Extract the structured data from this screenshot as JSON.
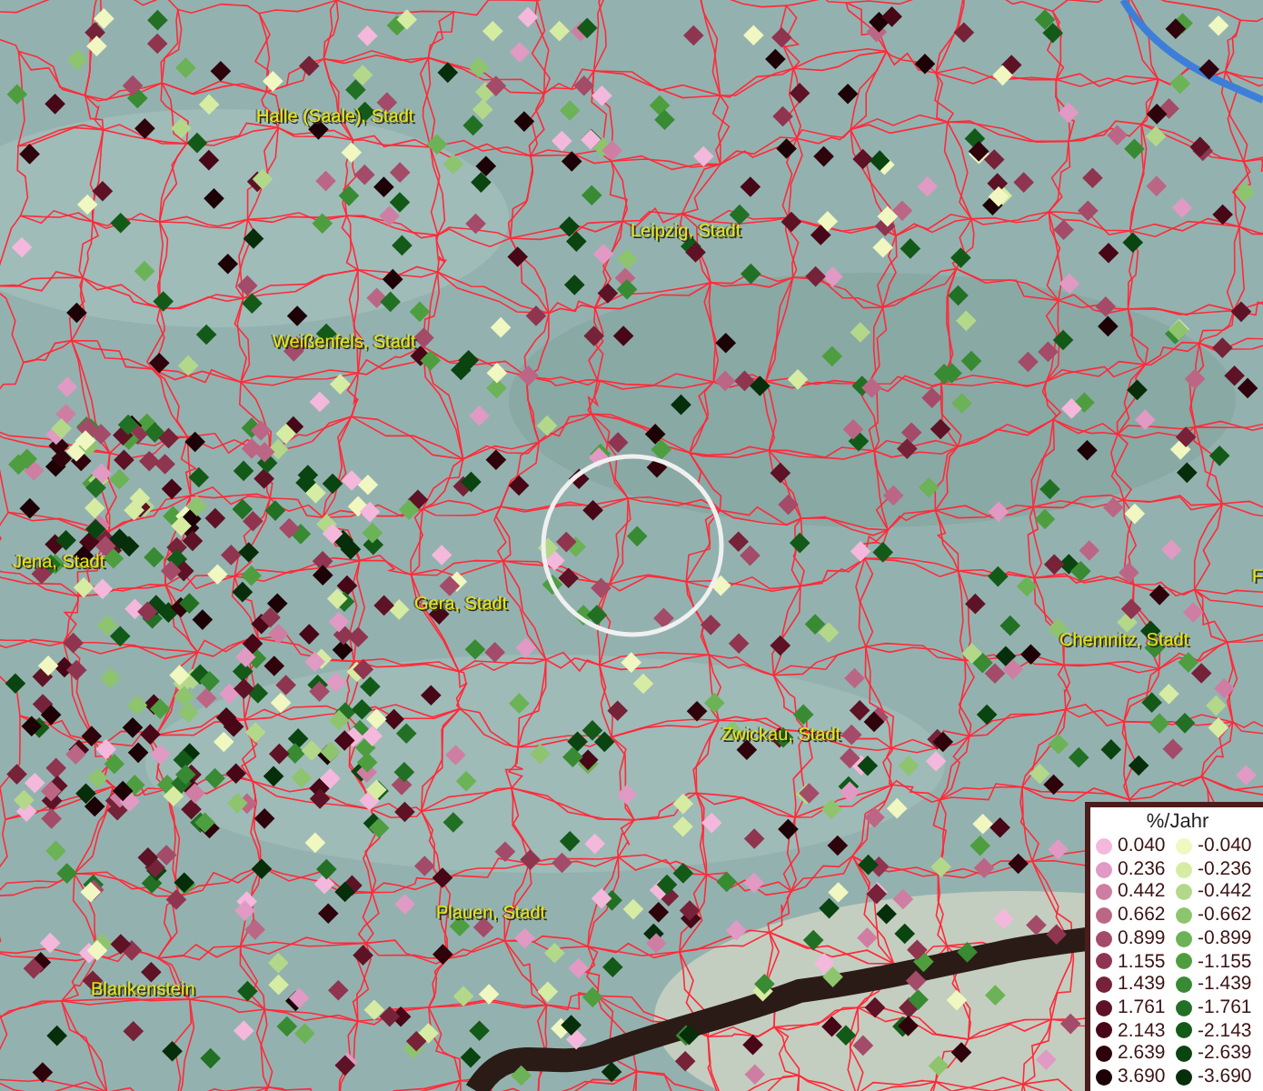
{
  "map": {
    "places": [
      {
        "name": "Halle (Saale), Stadt"
      },
      {
        "name": "Leipzig, Stadt"
      },
      {
        "name": "Weißenfels, Stadt"
      },
      {
        "name": "Jena, Stadt"
      },
      {
        "name": "Gera, Stadt"
      },
      {
        "name": "Chemnitz, Stadt"
      },
      {
        "name": "Zwickau, Stadt"
      },
      {
        "name": "Plauen, Stadt"
      },
      {
        "name": "Blankenstein"
      },
      {
        "name": "F"
      }
    ]
  },
  "legend": {
    "title": "%/Jahr",
    "rows": [
      {
        "positive": {
          "label": "0.040",
          "color": "#f4b8dc"
        },
        "negative": {
          "label": "-0.040",
          "color": "#f0f7c0"
        }
      },
      {
        "positive": {
          "label": "0.236",
          "color": "#e09ac4"
        },
        "negative": {
          "label": "-0.236",
          "color": "#d6eca2"
        }
      },
      {
        "positive": {
          "label": "0.442",
          "color": "#cf7ea3"
        },
        "negative": {
          "label": "-0.442",
          "color": "#b4d88a"
        }
      },
      {
        "positive": {
          "label": "0.662",
          "color": "#bc6686"
        },
        "negative": {
          "label": "-0.662",
          "color": "#8ec46e"
        }
      },
      {
        "positive": {
          "label": "0.899",
          "color": "#a34b68"
        },
        "negative": {
          "label": "-0.899",
          "color": "#6cb256"
        }
      },
      {
        "positive": {
          "label": "1.155",
          "color": "#8f3550"
        },
        "negative": {
          "label": "-1.155",
          "color": "#4e9e40"
        }
      },
      {
        "positive": {
          "label": "1.439",
          "color": "#762238"
        },
        "negative": {
          "label": "-1.439",
          "color": "#388a33"
        }
      },
      {
        "positive": {
          "label": "1.761",
          "color": "#5e1225"
        },
        "negative": {
          "label": "-1.761",
          "color": "#227024"
        }
      },
      {
        "positive": {
          "label": "2.143",
          "color": "#470716"
        },
        "negative": {
          "label": "-2.143",
          "color": "#135a18"
        }
      },
      {
        "positive": {
          "label": "2.639",
          "color": "#2f030c"
        },
        "negative": {
          "label": "-2.639",
          "color": "#0a4410"
        }
      },
      {
        "positive": {
          "label": "3.690",
          "color": "#1c0206"
        },
        "negative": {
          "label": "-3.690",
          "color": "#062e0a"
        }
      }
    ]
  }
}
